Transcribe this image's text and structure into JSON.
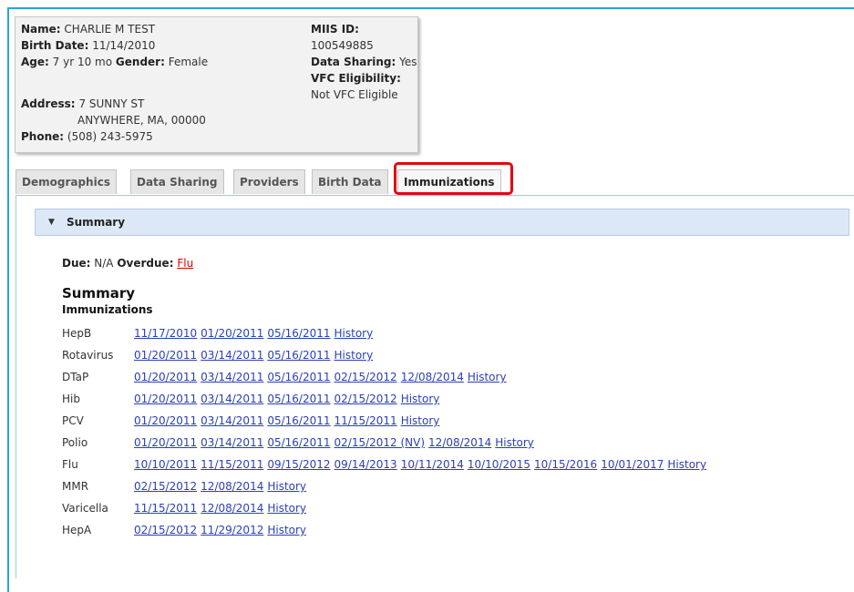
{
  "patient": {
    "name_label": "Name:",
    "name": "CHARLIE M TEST",
    "birth_label": "Birth Date:",
    "birth_date": "11/14/2010",
    "age_label": "Age:",
    "age": "7 yr 10 mo",
    "gender_label": "Gender:",
    "gender": "Female",
    "address_label": "Address:",
    "address_line1": "7 SUNNY ST",
    "address_line2": "ANYWHERE, MA, 00000",
    "phone_label": "Phone:",
    "phone": "(508) 243-5975",
    "miis_label": "MIIS ID:",
    "miis_id": "100549885",
    "sharing_label": "Data Sharing:",
    "data_sharing": "Yes",
    "vfc_label": "VFC Eligibility:",
    "vfc": "Not VFC Eligible"
  },
  "tabs": [
    "Demographics",
    "Data Sharing",
    "Providers",
    "Birth Data",
    "Immunizations"
  ],
  "active_tab": "Immunizations",
  "summary_section": {
    "header": "Summary",
    "due_label": "Due:",
    "due_value": "N/A",
    "overdue_label": "Overdue:",
    "overdue_value": "Flu",
    "title": "Summary",
    "subtitle": "Immunizations"
  },
  "immunizations": [
    {
      "vaccine": "HepB",
      "dates": [
        "11/17/2010",
        "01/20/2011",
        "05/16/2011"
      ],
      "history": "History"
    },
    {
      "vaccine": "Rotavirus",
      "dates": [
        "01/20/2011",
        "03/14/2011",
        "05/16/2011"
      ],
      "history": "History"
    },
    {
      "vaccine": "DTaP",
      "dates": [
        "01/20/2011",
        "03/14/2011",
        "05/16/2011",
        "02/15/2012",
        "12/08/2014"
      ],
      "history": "History"
    },
    {
      "vaccine": "Hib",
      "dates": [
        "01/20/2011",
        "03/14/2011",
        "05/16/2011",
        "02/15/2012"
      ],
      "history": "History"
    },
    {
      "vaccine": "PCV",
      "dates": [
        "01/20/2011",
        "03/14/2011",
        "05/16/2011",
        "11/15/2011"
      ],
      "history": "History"
    },
    {
      "vaccine": "Polio",
      "dates": [
        "01/20/2011",
        "03/14/2011",
        "05/16/2011",
        "02/15/2012 (NV)",
        "12/08/2014"
      ],
      "history": "History"
    },
    {
      "vaccine": "Flu",
      "dates": [
        "10/10/2011",
        "11/15/2011",
        "09/15/2012",
        "09/14/2013",
        "10/11/2014",
        "10/10/2015",
        "10/15/2016",
        "10/01/2017"
      ],
      "history": "History"
    },
    {
      "vaccine": "MMR",
      "dates": [
        "02/15/2012",
        "12/08/2014"
      ],
      "history": "History"
    },
    {
      "vaccine": "Varicella",
      "dates": [
        "11/15/2011",
        "12/08/2014"
      ],
      "history": "History"
    },
    {
      "vaccine": "HepA",
      "dates": [
        "02/15/2012",
        "11/29/2012"
      ],
      "history": "History"
    }
  ],
  "colors": {
    "accent_frame": "#29a3dd",
    "highlight": "#e30613",
    "link": "#2a3fb8",
    "overdue": "#e00000",
    "summary_bar": "#dde8f7"
  }
}
